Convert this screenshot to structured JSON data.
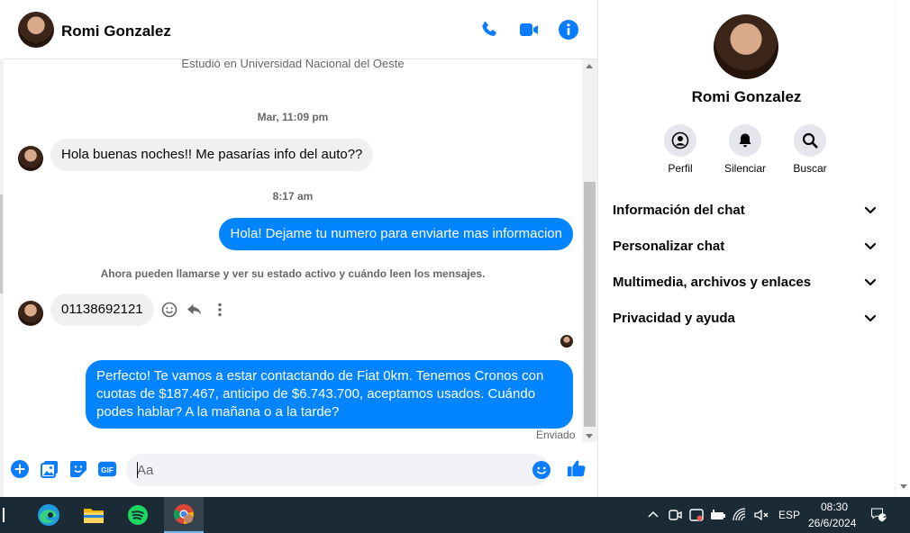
{
  "contact": {
    "name": "Romi Gonzalez"
  },
  "messages": {
    "profile_note": "Estudió en Universidad Nacional del Oeste",
    "timestamp_1": "Mar, 11:09 pm",
    "incoming_1": "Hola buenas noches!! Me pasarías info del auto??",
    "timestamp_2": "8:17 am",
    "outgoing_1": "Hola! Dejame tu numero para enviarte mas informacion",
    "system_note": "Ahora pueden llamarse y ver su estado activo y cuándo leen los mensajes.",
    "incoming_2": "01138692121",
    "outgoing_2": "Perfecto! Te vamos a estar contactando de Fiat 0km. Tenemos Cronos con cuotas de $187.467, anticipo de $6.743.700, aceptamos usados. Cuándo podes hablar? A la mañana o a la tarde?",
    "sent_status": "Enviado"
  },
  "composer": {
    "placeholder": "Aa",
    "gif_label": "GIF"
  },
  "info_panel": {
    "actions": [
      {
        "label": "Perfil",
        "icon": "user-icon"
      },
      {
        "label": "Silenciar",
        "icon": "bell-icon"
      },
      {
        "label": "Buscar",
        "icon": "search-icon"
      }
    ],
    "sections": [
      "Información del chat",
      "Personalizar chat",
      "Multimedia, archivos y enlaces",
      "Privacidad y ayuda"
    ]
  },
  "taskbar": {
    "apps": [
      "edge-icon",
      "file-explorer-icon",
      "spotify-icon",
      "chrome-icon"
    ],
    "language": "ESP",
    "time": "08:30",
    "date": "26/6/2024",
    "notifications": "2"
  },
  "colors": {
    "accent": "#0084ff",
    "icon_blue": "#0a7cff",
    "incoming_bubble": "#f0f0f0",
    "taskbar": "#1b2b36"
  }
}
